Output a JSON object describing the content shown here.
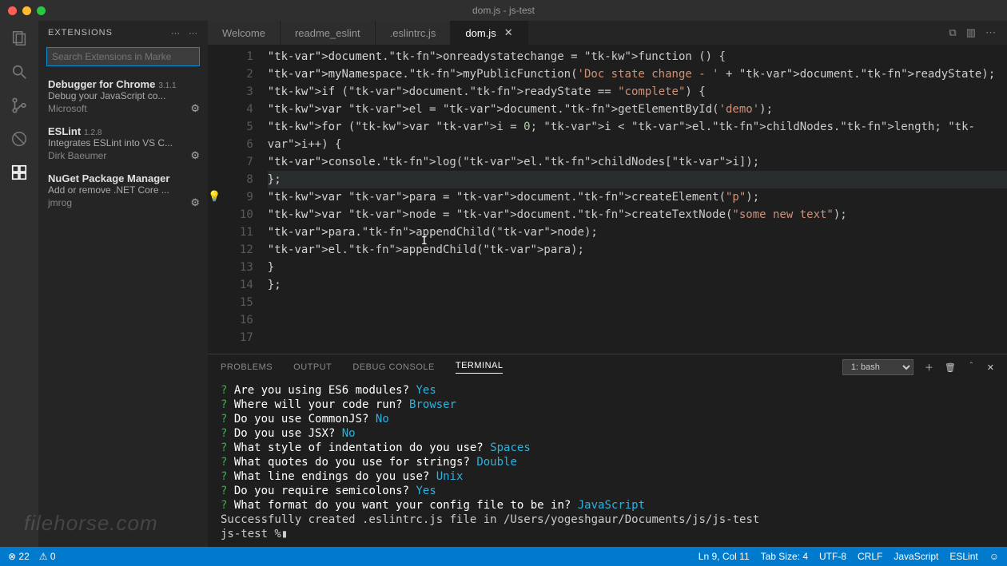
{
  "window": {
    "title": "dom.js - js-test"
  },
  "sidebar": {
    "header": "EXTENSIONS",
    "search_placeholder": "Search Extensions in Marke",
    "extensions": [
      {
        "name": "Debugger for Chrome",
        "version": "3.1.1",
        "desc": "Debug your JavaScript co...",
        "publisher": "Microsoft"
      },
      {
        "name": "ESLint",
        "version": "1.2.8",
        "desc": "Integrates ESLint into VS C...",
        "publisher": "Dirk Baeumer"
      },
      {
        "name": "NuGet Package Manager",
        "version": "",
        "desc": "Add or remove .NET Core ...",
        "publisher": "jmrog"
      }
    ]
  },
  "tabs": [
    {
      "label": "Welcome",
      "active": false
    },
    {
      "label": "readme_eslint",
      "active": false
    },
    {
      "label": ".eslintrc.js",
      "active": false
    },
    {
      "label": "dom.js",
      "active": true
    }
  ],
  "code_lines": [
    "document.onreadystatechange = function () {",
    "    myNamespace.myPublicFunction('Doc state change - ' + document.readyState);",
    "",
    "    if (document.readyState == \"complete\") {",
    "        var el = document.getElementById('demo');",
    "",
    "        for (var i = 0; i < el.childNodes.length; i++) {",
    "            console.log(el.childNodes[i]);",
    "        };",
    "",
    "        var para = document.createElement(\"p\");",
    "        var node = document.createTextNode(\"some new text\");",
    "        para.appendChild(node);",
    "",
    "        el.appendChild(para);",
    "    }",
    "};"
  ],
  "panel": {
    "tabs": [
      "PROBLEMS",
      "OUTPUT",
      "DEBUG CONSOLE",
      "TERMINAL"
    ],
    "active_tab": "TERMINAL",
    "terminal_selector": "1: bash",
    "lines": [
      {
        "q": "?",
        "prompt": "Are you using ES6 modules?",
        "ans": "Yes"
      },
      {
        "q": "?",
        "prompt": "Where will your code run?",
        "ans": "Browser"
      },
      {
        "q": "?",
        "prompt": "Do you use CommonJS?",
        "ans": "No"
      },
      {
        "q": "?",
        "prompt": "Do you use JSX?",
        "ans": "No"
      },
      {
        "q": "?",
        "prompt": "What style of indentation do you use?",
        "ans": "Spaces"
      },
      {
        "q": "?",
        "prompt": "What quotes do you use for strings?",
        "ans": "Double"
      },
      {
        "q": "?",
        "prompt": "What line endings do you use?",
        "ans": "Unix"
      },
      {
        "q": "?",
        "prompt": "Do you require semicolons?",
        "ans": "Yes"
      },
      {
        "q": "?",
        "prompt": "What format do you want your config file to be in?",
        "ans": "JavaScript"
      }
    ],
    "trailer1": "Successfully created .eslintrc.js file in /Users/yogeshgaur/Documents/js/js-test",
    "trailer2": "js-test %"
  },
  "statusbar": {
    "errors": "⊗ 22",
    "warnings": "⚠ 0",
    "ln_col": "Ln 9, Col 11",
    "tab_size": "Tab Size: 4",
    "encoding": "UTF-8",
    "eol": "CRLF",
    "lang": "JavaScript",
    "eslint": "ESLint",
    "smile": "☺"
  },
  "watermark": "filehorse.com"
}
